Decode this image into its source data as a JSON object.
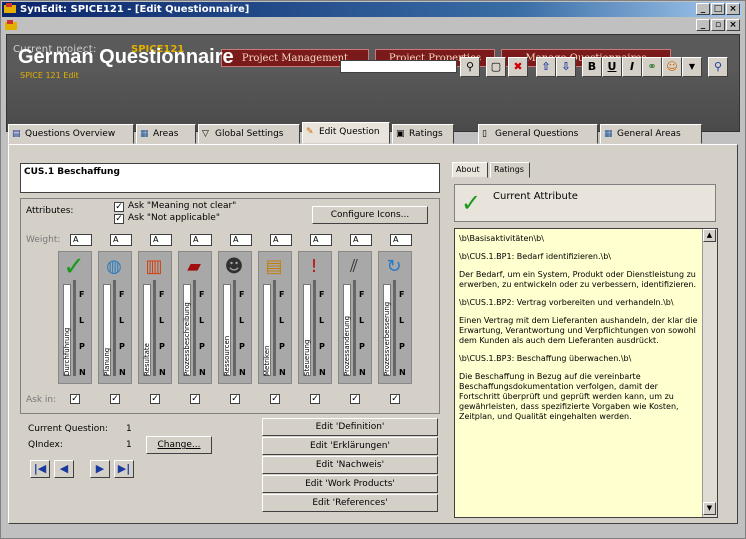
{
  "window": {
    "title": "SynEdit: SPICE121 - [Edit Questionnaire]"
  },
  "header": {
    "current_project_label": "Current project:",
    "current_project_value": "SPICE121",
    "buttons": [
      "Project Management",
      "Project Properties",
      "Manage Questionnaires"
    ],
    "title": "German Questionnaire",
    "subtitle": "SPICE 121 Edit",
    "search_value": ""
  },
  "tabs": [
    {
      "label": "Questions Overview",
      "icon": "list-icon"
    },
    {
      "label": "Areas",
      "icon": "areas-icon"
    },
    {
      "label": "Global Settings",
      "icon": "filter-icon"
    },
    {
      "label": "Edit Question",
      "icon": "pencil-icon"
    },
    {
      "label": "Ratings",
      "icon": "ratings-icon"
    },
    {
      "label": "General Questions",
      "icon": "document-icon"
    },
    {
      "label": "General Areas",
      "icon": "areas-icon"
    }
  ],
  "question": {
    "title": "CUS.1 Beschaffung",
    "attributes_label": "Attributes:",
    "ask_meaning": "Ask \"Meaning not clear\"",
    "ask_not_applicable": "Ask \"Not applicable\"",
    "configure_icons": "Configure Icons...",
    "weight_label": "Weight:",
    "ask_in_label": "Ask in:",
    "weight_value": "A",
    "scale": [
      "F",
      "L",
      "P",
      "N"
    ],
    "columns": [
      {
        "label": "Durchführung",
        "icon": "check-icon"
      },
      {
        "label": "Planung",
        "icon": "globe-icon"
      },
      {
        "label": "Resultate",
        "icon": "gift-icon"
      },
      {
        "label": "Prozessbeschreibung",
        "icon": "book-icon"
      },
      {
        "label": "Ressourcen",
        "icon": "person-icon"
      },
      {
        "label": "Metriken",
        "icon": "chart-icon"
      },
      {
        "label": "Steuerung",
        "icon": "alert-icon"
      },
      {
        "label": "Prozessanderung",
        "icon": "feather-icon"
      },
      {
        "label": "Prozessverbesserung",
        "icon": "recycle-icon"
      }
    ]
  },
  "status": {
    "current_question_label": "Current Question:",
    "current_question_value": "1",
    "qindex_label": "QIndex:",
    "qindex_value": "1",
    "change_button": "Change..."
  },
  "edit_buttons": [
    "Edit 'Definition'",
    "Edit 'Erklärungen'",
    "Edit 'Nachweis'",
    "Edit 'Work Products'",
    "Edit 'References'"
  ],
  "right": {
    "tabs": [
      "About",
      "Ratings"
    ],
    "current_attribute": "Current Attribute",
    "text": [
      "\\b\\Basisaktivitäten\\b\\",
      "\\b\\CUS.1.BP1:  Bedarf identifizieren.\\b\\",
      "Der Bedarf, um ein System, Produkt oder Dienstleistung zu erwerben, zu entwickeln oder zu verbessern, identifizieren.",
      "\\b\\CUS.1.BP2:  Vertrag vorbereiten und verhandeln.\\b\\",
      "Einen Vertrag mit dem Lieferanten aushandeln, der klar die Erwartung, Verantwortung und Verpflichtungen von sowohl dem Kunden als auch dem Lieferanten ausdrückt.",
      "\\b\\CUS.1.BP3:  Beschaffung überwachen.\\b\\",
      "Die Beschaffung in Bezug auf die vereinbarte Beschaffungsdokumentation verfolgen, damit der Fortschritt überprüft und geprüft werden kann, um zu gewährleisten, dass spezifizierte Vorgaben wie Kosten, Zeitplan, und Qualität eingehalten werden."
    ]
  }
}
